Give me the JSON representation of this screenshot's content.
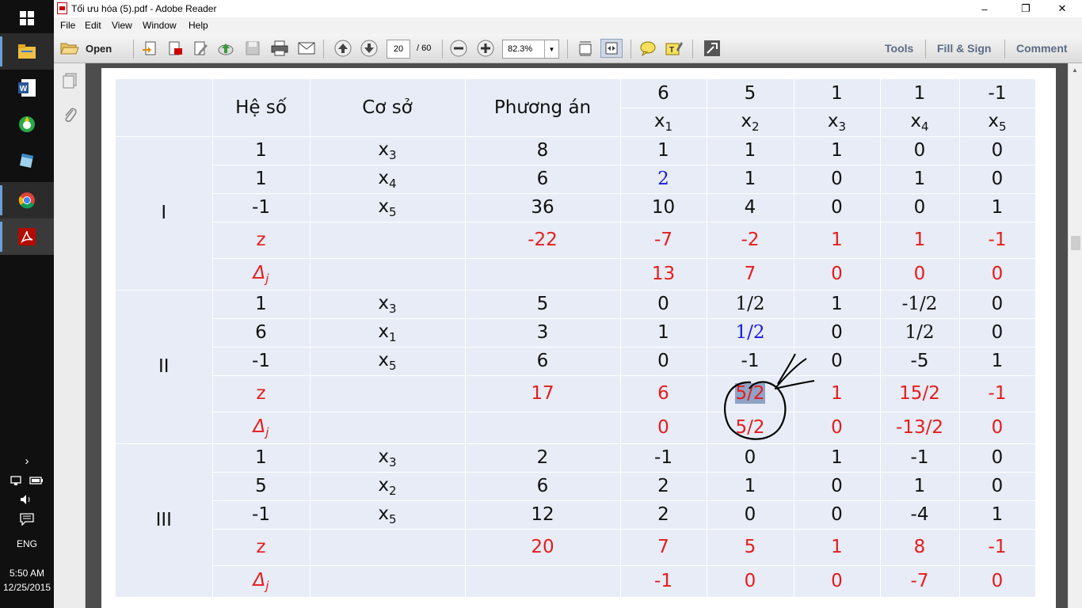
{
  "window": {
    "title": "Tối ưu hóa (5).pdf - Adobe Reader",
    "controls": {
      "minimize": "–",
      "maximize": "❐",
      "close": "✕"
    }
  },
  "menu": [
    "File",
    "Edit",
    "View",
    "Window",
    "Help"
  ],
  "toolbar": {
    "open_label": "Open",
    "page_current": "20",
    "page_total": "/ 60",
    "zoom": "82.3%",
    "right_links": [
      "Tools",
      "Fill & Sign",
      "Comment"
    ]
  },
  "taskbar": {
    "tray_language": "ENG",
    "clock_time": "5:50 AM",
    "clock_date": "12/25/2015"
  },
  "table": {
    "header": {
      "coef": "Hệ số",
      "basis": "Cơ sở",
      "plan": "Phương án",
      "objective_coefs": [
        "6",
        "5",
        "1",
        "1",
        "-1"
      ],
      "var_names": [
        "x",
        "x",
        "x",
        "x",
        "x"
      ],
      "var_subs": [
        "1",
        "2",
        "3",
        "4",
        "5"
      ]
    },
    "iterations": [
      {
        "label": "I",
        "rows": [
          {
            "coef": "1",
            "basis": "x",
            "sub": "3",
            "plan": "8",
            "values": [
              "1",
              "1",
              "1",
              "0",
              "0"
            ]
          },
          {
            "coef": "1",
            "basis": "x",
            "sub": "4",
            "plan": "6",
            "values": [
              "2",
              "1",
              "0",
              "1",
              "0"
            ]
          },
          {
            "coef": "-1",
            "basis": "x",
            "sub": "5",
            "plan": "36",
            "values": [
              "10",
              "4",
              "0",
              "0",
              "1"
            ]
          }
        ],
        "z": {
          "label": "z",
          "plan": "-22",
          "values": [
            "-7",
            "-2",
            "1",
            "1",
            "-1"
          ]
        },
        "delta": {
          "label": "Δ",
          "sub": "j",
          "plan": "",
          "values": [
            "13",
            "7",
            "0",
            "0",
            "0"
          ]
        }
      },
      {
        "label": "II",
        "rows": [
          {
            "coef": "1",
            "basis": "x",
            "sub": "3",
            "plan": "5",
            "values": [
              "0",
              "1/2",
              "1",
              "-1/2",
              "0"
            ]
          },
          {
            "coef": "6",
            "basis": "x",
            "sub": "1",
            "plan": "3",
            "values": [
              "1",
              "1/2",
              "0",
              "1/2",
              "0"
            ]
          },
          {
            "coef": "-1",
            "basis": "x",
            "sub": "5",
            "plan": "6",
            "values": [
              "0",
              "-1",
              "0",
              "-5",
              "1"
            ]
          }
        ],
        "z": {
          "label": "z",
          "plan": "17",
          "values": [
            "6",
            "5/2",
            "1",
            "15/2",
            "-1"
          ]
        },
        "delta": {
          "label": "Δ",
          "sub": "j",
          "plan": "",
          "values": [
            "0",
            "5/2",
            "0",
            "-13/2",
            "0"
          ]
        }
      },
      {
        "label": "III",
        "rows": [
          {
            "coef": "1",
            "basis": "x",
            "sub": "3",
            "plan": "2",
            "values": [
              "-1",
              "0",
              "1",
              "-1",
              "0"
            ]
          },
          {
            "coef": "5",
            "basis": "x",
            "sub": "2",
            "plan": "6",
            "values": [
              "2",
              "1",
              "0",
              "1",
              "0"
            ]
          },
          {
            "coef": "-1",
            "basis": "x",
            "sub": "5",
            "plan": "12",
            "values": [
              "2",
              "0",
              "0",
              "-4",
              "1"
            ]
          }
        ],
        "z": {
          "label": "z",
          "plan": "20",
          "values": [
            "7",
            "5",
            "1",
            "8",
            "-1"
          ]
        },
        "delta": {
          "label": "Δ",
          "sub": "j",
          "plan": "",
          "values": [
            "-1",
            "0",
            "0",
            "-7",
            "0"
          ]
        }
      }
    ]
  },
  "colors": {
    "z_delta_text": "#e61c1c",
    "pivot_text": "#1a1adc",
    "table_bg": "#e7ecf6",
    "selection": "#8ea3c6"
  }
}
